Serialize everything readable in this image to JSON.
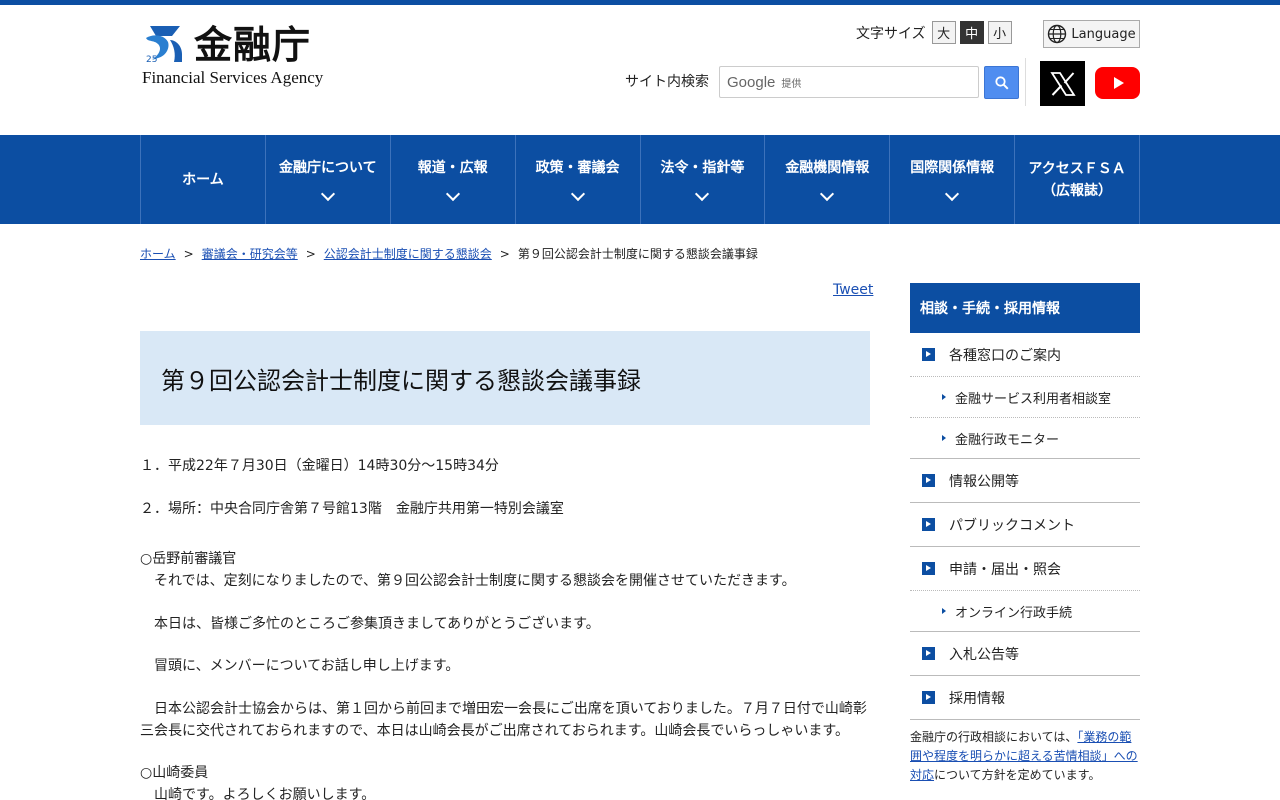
{
  "header": {
    "logo_jp": "金融庁",
    "logo_en": "Financial Services Agency",
    "fontsize_label": "文字サイズ",
    "fontsize_options": [
      "大",
      "中",
      "小"
    ],
    "fontsize_selected": "中",
    "language_label": "Language",
    "search_label": "サイト内検索",
    "search_google": "Google",
    "search_provided": "提供",
    "icons": {
      "search": "search-icon",
      "globe": "globe-icon",
      "x": "x-logo-icon",
      "youtube": "youtube-icon"
    }
  },
  "nav": {
    "items": [
      {
        "label": "ホーム",
        "has_dropdown": false
      },
      {
        "label": "金融庁について",
        "has_dropdown": true
      },
      {
        "label": "報道・広報",
        "has_dropdown": true
      },
      {
        "label": "政策・審議会",
        "has_dropdown": true
      },
      {
        "label": "法令・指針等",
        "has_dropdown": true
      },
      {
        "label": "金融機関情報",
        "has_dropdown": true
      },
      {
        "label": "国際関係情報",
        "has_dropdown": true
      },
      {
        "label": "アクセスＦＳＡ\n（広報誌）",
        "has_dropdown": false
      }
    ]
  },
  "breadcrumb": {
    "items": [
      "ホーム",
      "審議会・研究会等",
      "公認会計士制度に関する懇談会"
    ],
    "current": "第９回公認会計士制度に関する懇談会議事録",
    "separator": ">"
  },
  "tweet_label": "Tweet",
  "page_title": "第９回公認会計士制度に関する懇談会議事録",
  "content": {
    "meta": [
      "１．平成22年７月30日（金曜日）14時30分～15時34分",
      "２．場所：中央合同庁舎第７号館13階　金融庁共用第一特別会議室"
    ],
    "speaker1": "○岳野前審議官",
    "para1": "それでは、定刻になりましたので、第９回公認会計士制度に関する懇談会を開催させていただきます。",
    "para2": "本日は、皆様ご多忙のところご参集頂きましてありがとうございます。",
    "para3": "冒頭に、メンバーについてお話し申し上げます。",
    "para4_line1": "日本公認会計士協会からは、第１回から前回まで増田宏一会長にご出席を頂いておりました。７月７日付で山崎彰",
    "para4_line2": "三会長に交代されておられますので、本日は山崎会長がご出席されておられます。山崎会長でいらっしゃいます。",
    "speaker2": "○山崎委員",
    "para5": "山崎です。よろしくお願いします。"
  },
  "sidebar": {
    "heading": "相談・手続・採用情報",
    "items": [
      {
        "label": "各種窓口のご案内",
        "subs": [
          "金融サービス利用者相談室",
          "金融行政モニター"
        ]
      },
      {
        "label": "情報公開等",
        "subs": []
      },
      {
        "label": "パブリックコメント",
        "subs": []
      },
      {
        "label": "申請・届出・照会",
        "subs": [
          "オンライン行政手続"
        ]
      },
      {
        "label": "入札公告等",
        "subs": []
      },
      {
        "label": "採用情報",
        "subs": []
      }
    ],
    "note_prefix": "金融庁の行政相談においては、",
    "note_link": "「業務の範囲や程度を明らかに超える苦情相談」への対応",
    "note_suffix": "について方針を定めています。"
  },
  "colors": {
    "brand": "#0c4ea2",
    "title_bg": "#d9e8f6",
    "link": "#1a4fb3",
    "youtube": "#ff0000"
  }
}
